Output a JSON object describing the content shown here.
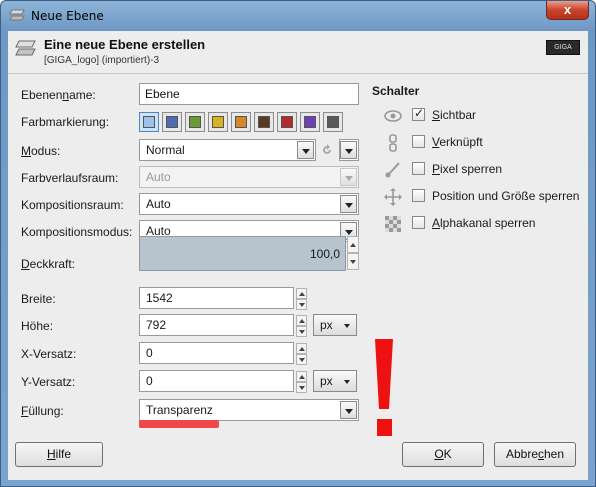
{
  "window": {
    "title": "Neue Ebene",
    "close": "x"
  },
  "header": {
    "title": "Eine neue Ebene erstellen",
    "subtitle": "[GIGA_logo] (importiert)-3",
    "thumb_text": "GIGA"
  },
  "form": {
    "layer_name": {
      "label_pre": "Ebenen",
      "label_u": "n",
      "label_post": "ame:",
      "value": "Ebene"
    },
    "color_tag": {
      "label": "Farbmarkierung:",
      "swatches": [
        "#9ec3ea",
        "#4d6db0",
        "#6a9a34",
        "#d7b221",
        "#d6872a",
        "#5a3a1c",
        "#b42a2a",
        "#6f3fb5",
        "#595959"
      ]
    },
    "mode": {
      "label_u": "M",
      "label_post": "odus:",
      "value": "Normal"
    },
    "blend_space": {
      "label": "Farbverlaufsraum:",
      "value": "Auto"
    },
    "composite_space": {
      "label": "Kompositionsraum:",
      "value": "Auto"
    },
    "composite_mode": {
      "label": "Kompositionsmodus:",
      "value": "Auto"
    },
    "opacity": {
      "label_u": "D",
      "label_post": "eckkraft:",
      "value": "100,0"
    },
    "width": {
      "label": "Breite:",
      "value": "1542"
    },
    "height": {
      "label": "Höhe:",
      "value": "792",
      "unit": "px"
    },
    "offset_x": {
      "label": "X-Versatz:",
      "value": "0"
    },
    "offset_y": {
      "label": "Y-Versatz:",
      "value": "0",
      "unit": "px"
    },
    "fill": {
      "label_u": "F",
      "label_post": "üllung:",
      "value": "Transparenz"
    }
  },
  "switches": {
    "title": "Schalter",
    "items": [
      {
        "label_u": "S",
        "label_post": "ichtbar",
        "checked": true,
        "icon": "eye-icon"
      },
      {
        "label_u": "V",
        "label_post": "erknüpft",
        "checked": false,
        "icon": "chain-icon"
      },
      {
        "label_u": "P",
        "label_post": "ixel sperren",
        "checked": false,
        "icon": "brush-icon"
      },
      {
        "label_u": "",
        "label_post": "Position und Größe sperren",
        "checked": false,
        "icon": "move-icon"
      },
      {
        "label_u": "A",
        "label_post": "lphakanal sperren",
        "checked": false,
        "icon": "checkerboard-icon"
      }
    ]
  },
  "buttons": {
    "help_u": "H",
    "help_post": "ilfe",
    "ok_u": "O",
    "ok_post": "K",
    "cancel_pre": "Abbre",
    "cancel_u": "c",
    "cancel_post": "hen"
  },
  "colors": {
    "accent_red": "#f04848"
  }
}
